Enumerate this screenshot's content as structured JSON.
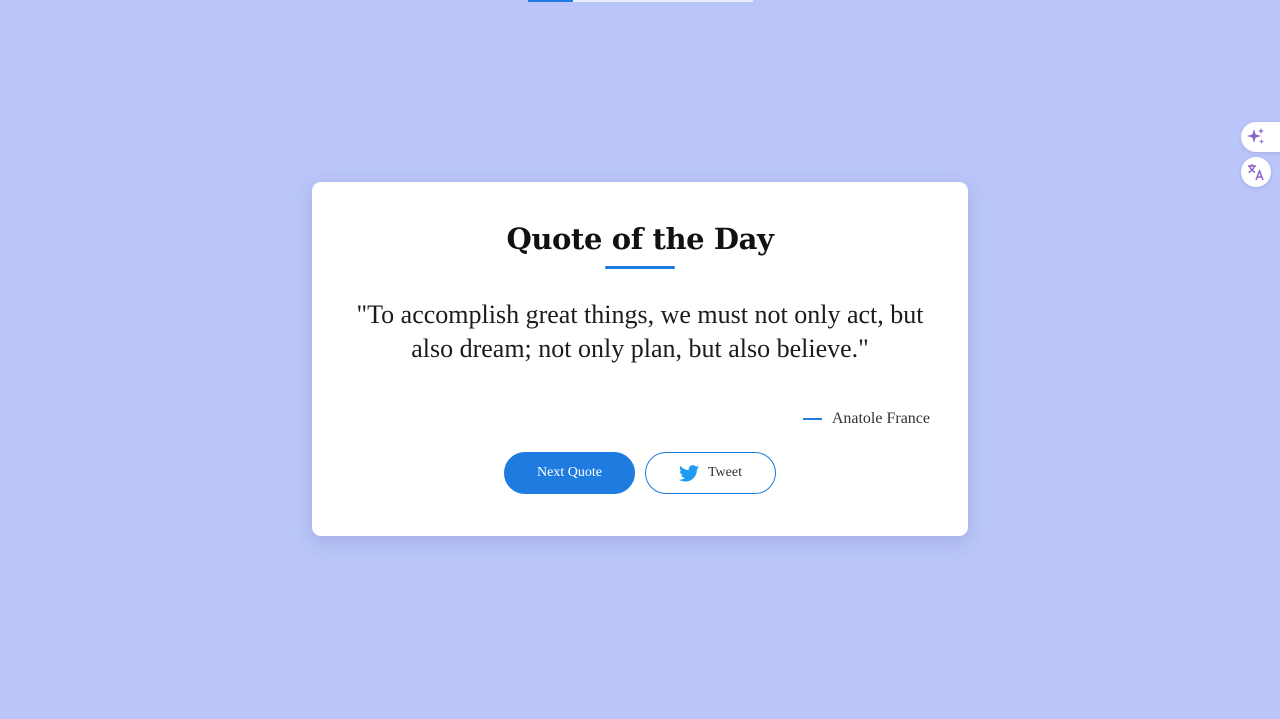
{
  "card": {
    "title": "Quote of the Day",
    "quote": "\"To accomplish great things, we must not only act, but also dream; not only plan, but also believe.\"",
    "author": "Anatole France"
  },
  "buttons": {
    "next_label": "Next Quote",
    "tweet_label": "Tweet"
  },
  "top_progress": {
    "fill_fraction": 0.2
  },
  "side_widgets": {
    "icons": [
      "sparkle-icon",
      "translate-icon"
    ]
  },
  "colors": {
    "background": "#bac6f9",
    "accent": "#1e7be0",
    "card": "#ffffff",
    "widget_icon": "#8a63c9"
  }
}
